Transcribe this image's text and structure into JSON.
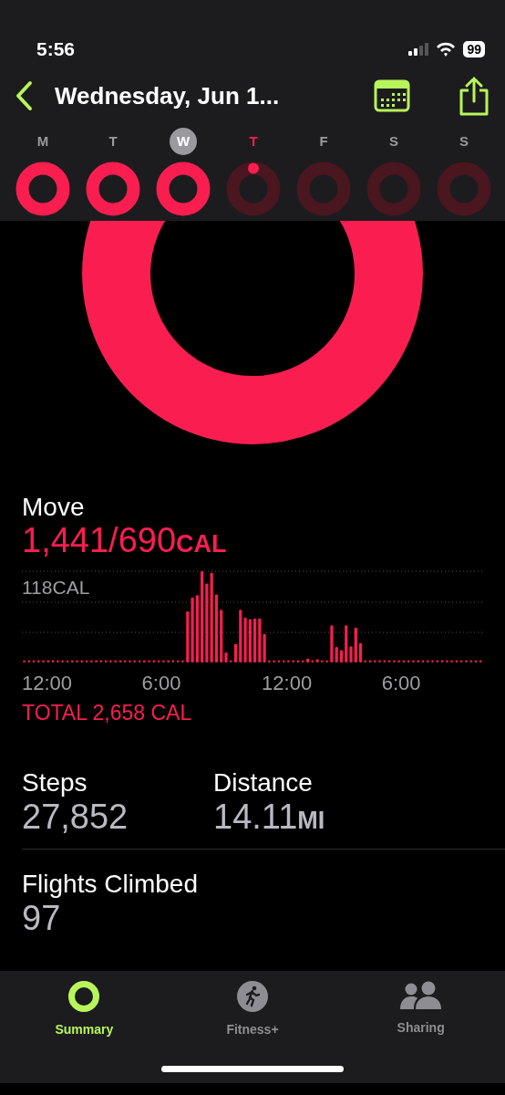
{
  "status_bar": {
    "time": "5:56",
    "battery": "99"
  },
  "header": {
    "title": "Wednesday, Jun 1..."
  },
  "week": [
    {
      "label": "M",
      "selected": false,
      "today": false,
      "complete": true
    },
    {
      "label": "T",
      "selected": false,
      "today": false,
      "complete": true
    },
    {
      "label": "W",
      "selected": true,
      "today": false,
      "complete": true
    },
    {
      "label": "T",
      "selected": false,
      "today": true,
      "complete": false
    },
    {
      "label": "F",
      "selected": false,
      "today": false,
      "complete": false
    },
    {
      "label": "S",
      "selected": false,
      "today": false,
      "complete": false
    },
    {
      "label": "S",
      "selected": false,
      "today": false,
      "complete": false
    }
  ],
  "move": {
    "label": "Move",
    "value": "1,441/690",
    "unit": "CAL",
    "total": "TOTAL 2,658 CAL",
    "chart_peak_label": "118CAL",
    "chart_time_labels": [
      "12:00",
      "6:00",
      "12:00",
      "6:00"
    ]
  },
  "stats": [
    {
      "label": "Steps",
      "value": "27,852"
    },
    {
      "label": "Distance",
      "value": "14.11",
      "unit": "MI"
    }
  ],
  "flights": {
    "label": "Flights Climbed",
    "value": "97"
  },
  "tab_bar": [
    {
      "label": "Summary",
      "kind": "rings",
      "selected": true
    },
    {
      "label": "Fitness+",
      "kind": "runner",
      "selected": false
    },
    {
      "label": "Sharing",
      "kind": "people",
      "selected": false
    }
  ]
}
